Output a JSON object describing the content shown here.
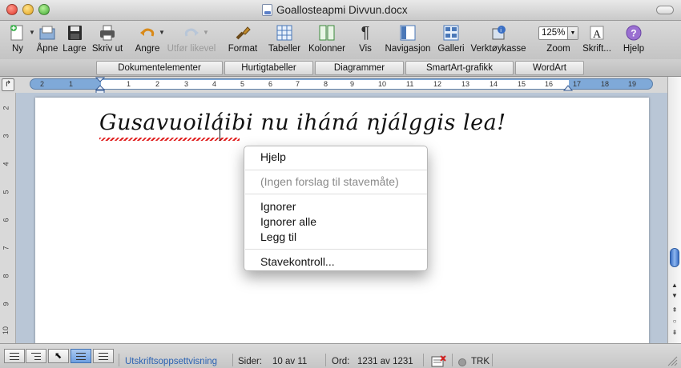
{
  "window": {
    "title": "Goallosteapmi Divvun.docx"
  },
  "toolbar": {
    "items": [
      {
        "label": "Ny",
        "icon": "new-document-icon"
      },
      {
        "label": "Åpne",
        "icon": "open-folder-icon"
      },
      {
        "label": "Lagre",
        "icon": "save-disk-icon"
      },
      {
        "label": "Skriv ut",
        "icon": "printer-icon"
      },
      {
        "label": "Angre",
        "icon": "undo-icon"
      },
      {
        "label": "Utfør likevel",
        "icon": "redo-icon",
        "disabled": true
      },
      {
        "label": "Format",
        "icon": "format-brush-icon"
      },
      {
        "label": "Tabeller",
        "icon": "table-icon"
      },
      {
        "label": "Kolonner",
        "icon": "columns-icon"
      },
      {
        "label": "Vis",
        "icon": "pilcrow-icon"
      },
      {
        "label": "Navigasjon",
        "icon": "navigation-pane-icon"
      },
      {
        "label": "Galleri",
        "icon": "gallery-icon"
      },
      {
        "label": "Verktøykasse",
        "icon": "toolbox-icon"
      },
      {
        "label": "Zoom",
        "icon": "zoom-select-icon"
      },
      {
        "label": "Skrift...",
        "icon": "font-icon"
      },
      {
        "label": "Hjelp",
        "icon": "help-icon"
      }
    ],
    "zoom_value": "125%"
  },
  "ribbon_tabs": [
    "Dokumentelementer",
    "Hurtigtabeller",
    "Diagrammer",
    "SmartArt-grafikk",
    "WordArt"
  ],
  "ruler": {
    "numbers": [
      "2",
      "1",
      "1",
      "2",
      "3",
      "4",
      "5",
      "6",
      "7",
      "8",
      "9",
      "10",
      "11",
      "12",
      "13",
      "14",
      "15",
      "16",
      "17",
      "18",
      "19"
    ]
  },
  "vertical_ruler": {
    "numbers": [
      "2",
      "3",
      "4",
      "5",
      "6",
      "7",
      "8",
      "9",
      "10"
    ]
  },
  "document": {
    "text": "Gusavuoiláibi nu iháná njálggis lea!"
  },
  "context_menu": {
    "items": [
      {
        "label": "Hjelp",
        "disabled": false
      },
      {
        "label": "(Ingen forslag til stavemåte)",
        "disabled": true
      },
      {
        "label": "Ignorer",
        "disabled": false
      },
      {
        "label": "Ignorer alle",
        "disabled": false
      },
      {
        "label": "Legg til",
        "disabled": false
      },
      {
        "label": "Stavekontroll...",
        "disabled": false
      }
    ]
  },
  "status": {
    "view_name": "Utskriftsoppsettvisning",
    "pages_label": "Sider:",
    "pages_value": "10 av 11",
    "words_label": "Ord:",
    "words_value": "1231 av 1231",
    "trk": "TRK"
  },
  "colors": {
    "accent": "#3a6fc4",
    "spell_error": "#e02020"
  }
}
